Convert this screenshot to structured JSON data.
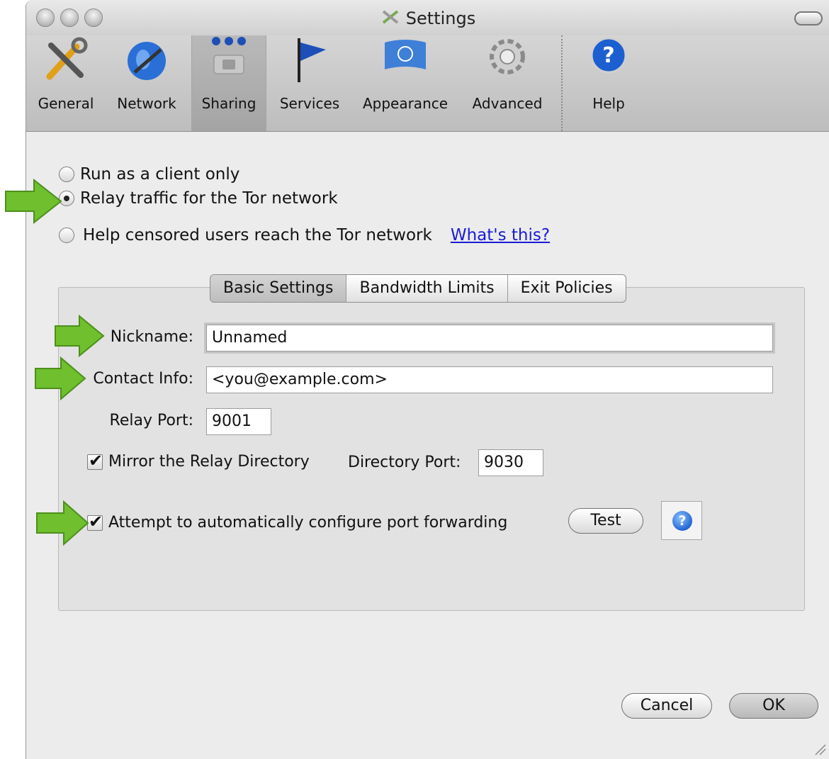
{
  "window": {
    "title": "Settings"
  },
  "toolbar": {
    "items": [
      {
        "label": "General",
        "icon": "wrench-screwdriver-icon"
      },
      {
        "label": "Network",
        "icon": "globe-icon"
      },
      {
        "label": "Sharing",
        "icon": "sharing-icon"
      },
      {
        "label": "Services",
        "icon": "flag-icon"
      },
      {
        "label": "Appearance",
        "icon": "un-flag-icon"
      },
      {
        "label": "Advanced",
        "icon": "gear-icon"
      },
      {
        "label": "Help",
        "icon": "question-icon"
      }
    ],
    "active": "Sharing"
  },
  "mode": {
    "options": [
      {
        "label": "Run as a client only",
        "checked": false
      },
      {
        "label": "Relay traffic for the Tor network",
        "checked": true
      },
      {
        "label": "Help censored users reach the Tor network",
        "checked": false
      }
    ],
    "whats_this": "What's this?"
  },
  "tabs": {
    "items": [
      "Basic Settings",
      "Bandwidth Limits",
      "Exit Policies"
    ],
    "active": "Basic Settings"
  },
  "form": {
    "nickname_label": "Nickname:",
    "nickname": "Unnamed",
    "contact_label": "Contact Info:",
    "contact": "<you@example.com>",
    "relay_port_label": "Relay Port:",
    "relay_port": "9001",
    "mirror_label": "Mirror the Relay Directory",
    "mirror_checked": true,
    "dir_port_label": "Directory Port:",
    "dir_port": "9030",
    "upnp_label": "Attempt to automatically configure port forwarding",
    "upnp_checked": true,
    "test_button": "Test",
    "help_button": "?"
  },
  "footer": {
    "cancel": "Cancel",
    "ok": "OK"
  },
  "colors": {
    "arrow": "#6fbf2e",
    "link": "#1a1ad6",
    "help_blue": "#1c5fd0"
  }
}
